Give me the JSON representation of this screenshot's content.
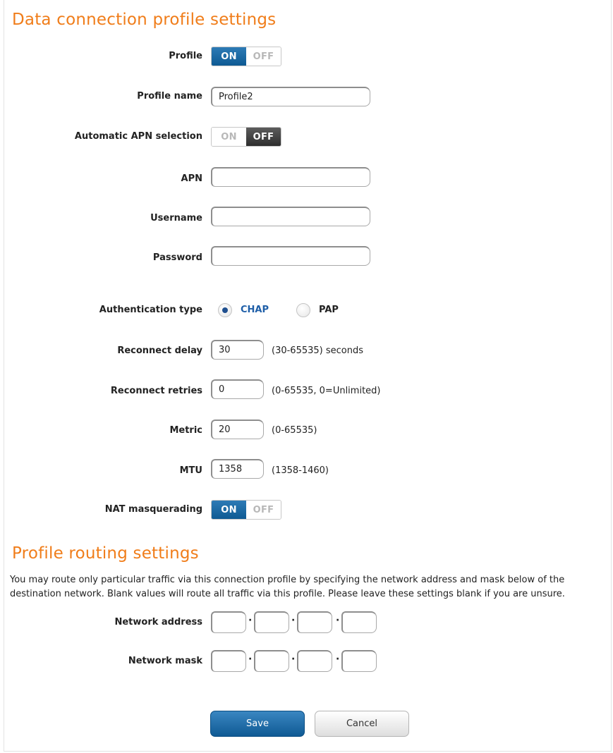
{
  "section1": {
    "title": "Data connection profile settings",
    "profile": {
      "label": "Profile",
      "on": "ON",
      "off": "OFF",
      "state": "on"
    },
    "profile_name": {
      "label": "Profile name",
      "value": "Profile2"
    },
    "auto_apn": {
      "label": "Automatic APN selection",
      "on": "ON",
      "off": "OFF",
      "state": "off"
    },
    "apn": {
      "label": "APN",
      "value": ""
    },
    "username": {
      "label": "Username",
      "value": ""
    },
    "password": {
      "label": "Password",
      "value": ""
    },
    "auth": {
      "label": "Authentication type",
      "options": [
        "CHAP",
        "PAP"
      ],
      "selected": "CHAP"
    },
    "reconnect_delay": {
      "label": "Reconnect delay",
      "value": "30",
      "hint": "(30-65535) seconds"
    },
    "reconnect_retries": {
      "label": "Reconnect retries",
      "value": "0",
      "hint": "(0-65535, 0=Unlimited)"
    },
    "metric": {
      "label": "Metric",
      "value": "20",
      "hint": "(0-65535)"
    },
    "mtu": {
      "label": "MTU",
      "value": "1358",
      "hint": "(1358-1460)"
    },
    "nat": {
      "label": "NAT masquerading",
      "on": "ON",
      "off": "OFF",
      "state": "on"
    }
  },
  "section2": {
    "title": "Profile routing settings",
    "description": "You may route only particular traffic via this connection profile by specifying the network address and mask below of the destination network. Blank values will route all traffic via this profile. Please leave these settings blank if you are unsure.",
    "network_address": {
      "label": "Network address",
      "octets": [
        "",
        "",
        "",
        ""
      ]
    },
    "network_mask": {
      "label": "Network mask",
      "octets": [
        "",
        "",
        "",
        ""
      ]
    }
  },
  "buttons": {
    "save": "Save",
    "cancel": "Cancel"
  },
  "colors": {
    "heading": "#f07d1a",
    "toggle_on": "#0e5a93",
    "toggle_off": "#2e2e2e",
    "radio_selected_label": "#1f5fa8"
  }
}
